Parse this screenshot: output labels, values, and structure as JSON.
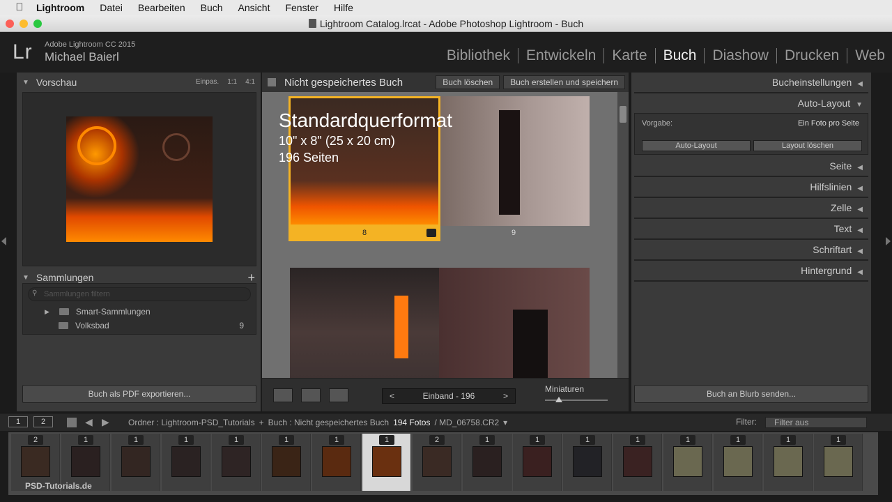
{
  "menubar": {
    "app": "Lightroom",
    "items": [
      "Datei",
      "Bearbeiten",
      "Buch",
      "Ansicht",
      "Fenster",
      "Hilfe"
    ]
  },
  "window": {
    "title": "Lightroom Catalog.lrcat - Adobe Photoshop Lightroom - Buch"
  },
  "identity": {
    "logo": "Lr",
    "product": "Adobe Lightroom CC 2015",
    "user": "Michael Baierl"
  },
  "modules": [
    "Bibliothek",
    "Entwickeln",
    "Karte",
    "Buch",
    "Diashow",
    "Drucken",
    "Web"
  ],
  "active_module": "Buch",
  "left_panel": {
    "navigator": {
      "title": "Vorschau",
      "zoom": [
        "Einpas.",
        "1:1",
        "4:1"
      ]
    },
    "collections": {
      "title": "Sammlungen",
      "add": "+",
      "search_placeholder": "Sammlungen filtern",
      "items": [
        {
          "label": "Smart-Sammlungen",
          "count": ""
        },
        {
          "label": "Volksbad",
          "count": "9"
        }
      ]
    },
    "export_label": "Buch als PDF exportieren..."
  },
  "center": {
    "title": "Nicht gespeichertes Buch",
    "delete_label": "Buch löschen",
    "create_label": "Buch erstellen und speichern",
    "overlay": {
      "format": "Standardquerformat",
      "size": "10\" x 8\" (25 x 20 cm)",
      "pages": "196 Seiten"
    },
    "page_numbers": [
      "8",
      "9"
    ],
    "toolbar": {
      "page_label": "Einband - 196",
      "prev": "<",
      "next": ">",
      "thumbs_label": "Miniaturen",
      "thumb_size": 0.22
    }
  },
  "right_panel": {
    "sections": [
      "Bucheinstellungen",
      "Auto-Layout",
      "Seite",
      "Hilfslinien",
      "Zelle",
      "Text",
      "Schriftart",
      "Hintergrund"
    ],
    "vorgabe_label": "Vorgabe:",
    "vorgabe_value": "Ein Foto pro Seite",
    "autolayout_btn": "Auto-Layout",
    "clear_btn": "Layout löschen",
    "blurb_label": "Buch an Blurb senden..."
  },
  "filmstrip_bar": {
    "monitor1": "1",
    "monitor2": "2",
    "folder": "Ordner : Lightroom-PSD_Tutorials",
    "plus": "+",
    "book": "Buch : Nicht gespeichertes Buch",
    "count": "194 Fotos",
    "file": "/ MD_06758.CR2",
    "filter_label": "Filter:",
    "filter_value": "Filter aus"
  },
  "filmstrip": {
    "badges": [
      "2",
      "1",
      "1",
      "1",
      "1",
      "1",
      "1",
      "1",
      "2",
      "1",
      "1",
      "1",
      "1",
      "1",
      "1",
      "1",
      "1"
    ],
    "selected_index": 7
  },
  "watermark": "PSD-Tutorials.de",
  "colors": {
    "selection": "#f4b324",
    "panel": "#3a3a3a"
  }
}
